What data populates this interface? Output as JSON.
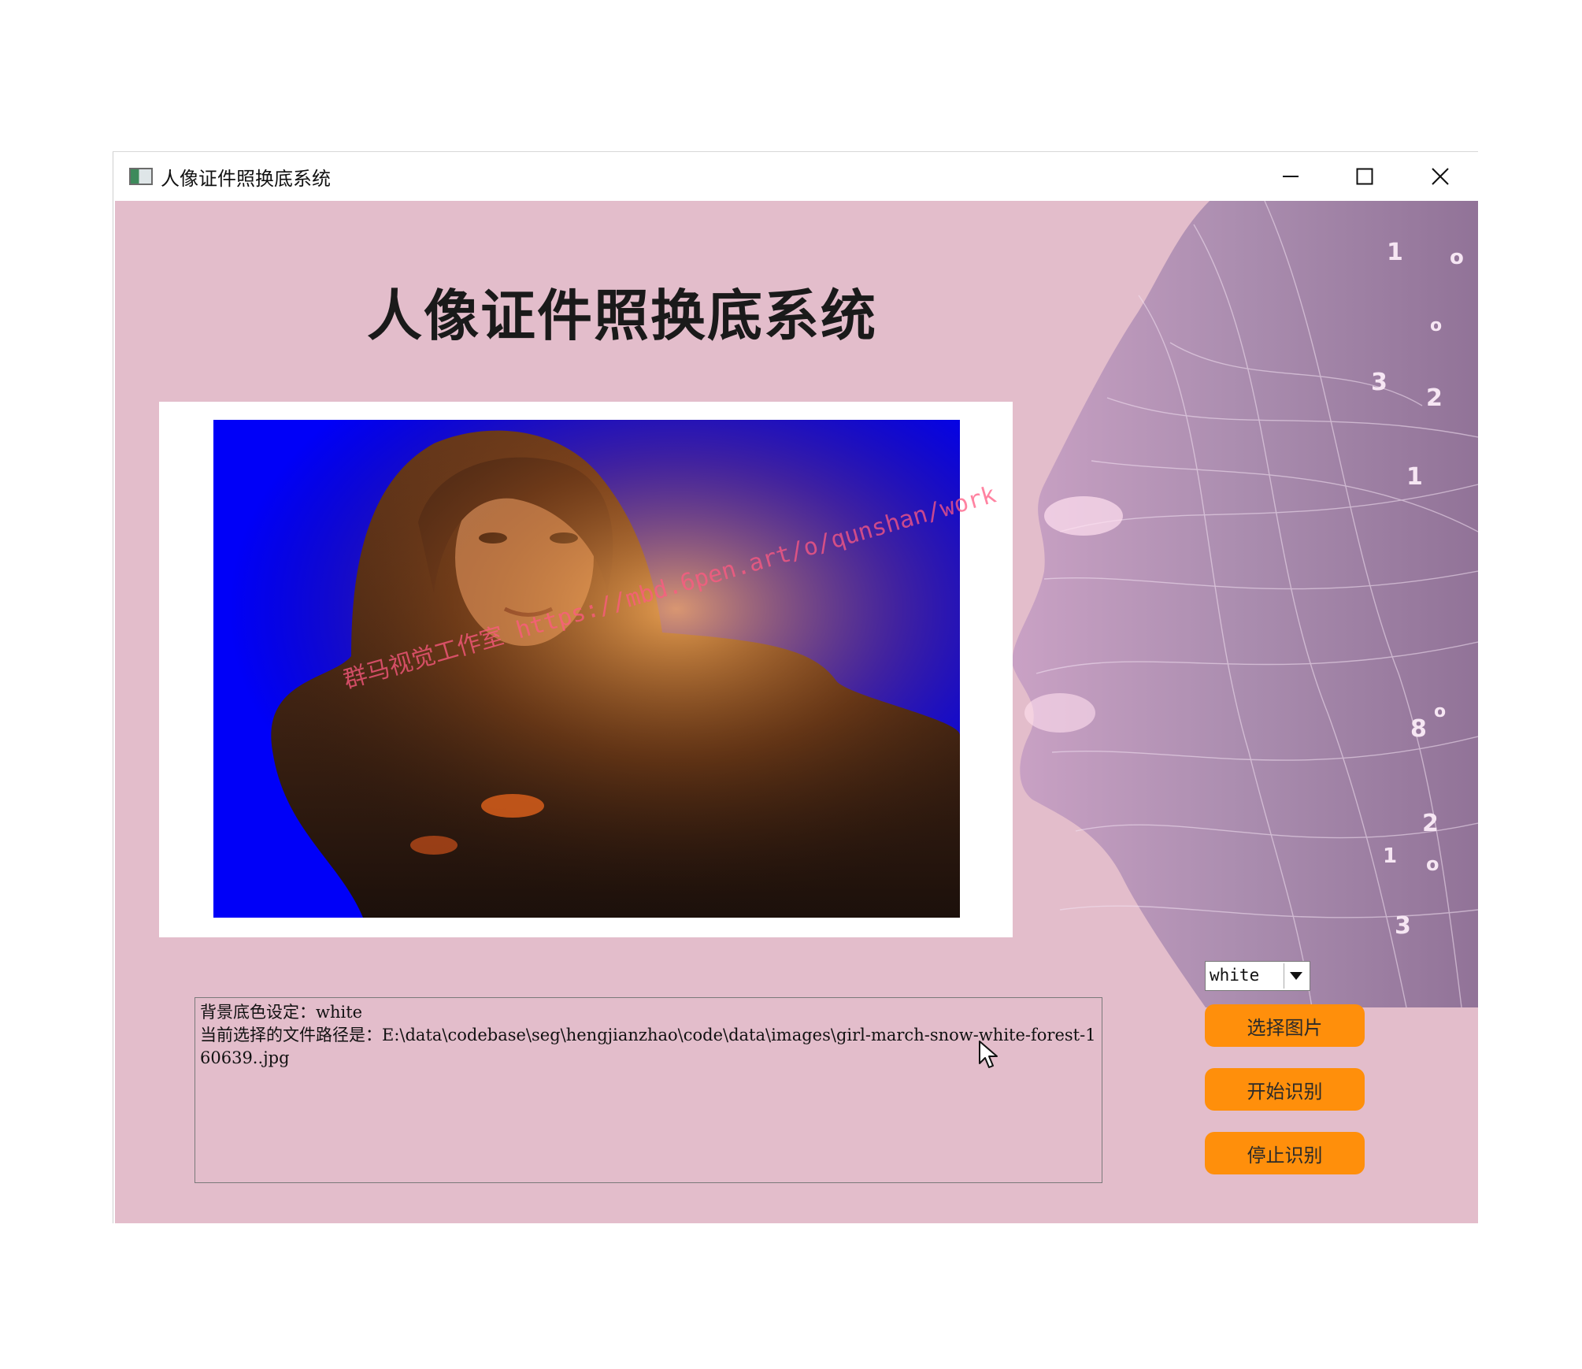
{
  "window": {
    "title": "人像证件照换底系统"
  },
  "main": {
    "heading": "人像证件照换底系统",
    "photo": {
      "background_color": "#0000f8"
    },
    "log": {
      "line1": "背景底色设定：white",
      "line2": "当前选择的文件路径是：E:\\data\\codebase\\seg\\hengjianzhao\\code\\data\\images\\girl-march-snow-white-forest-160639..jpg"
    }
  },
  "controls": {
    "color_select": {
      "selected": "white"
    },
    "select_image_label": "选择图片",
    "start_label": "开始识别",
    "stop_label": "停止识别"
  },
  "watermark": "群马视觉工作室 https://mbd.6pen.art/o/qunshan/work",
  "colors": {
    "client_background": "#e3bdcb",
    "button_orange": "#ff8f0b"
  }
}
